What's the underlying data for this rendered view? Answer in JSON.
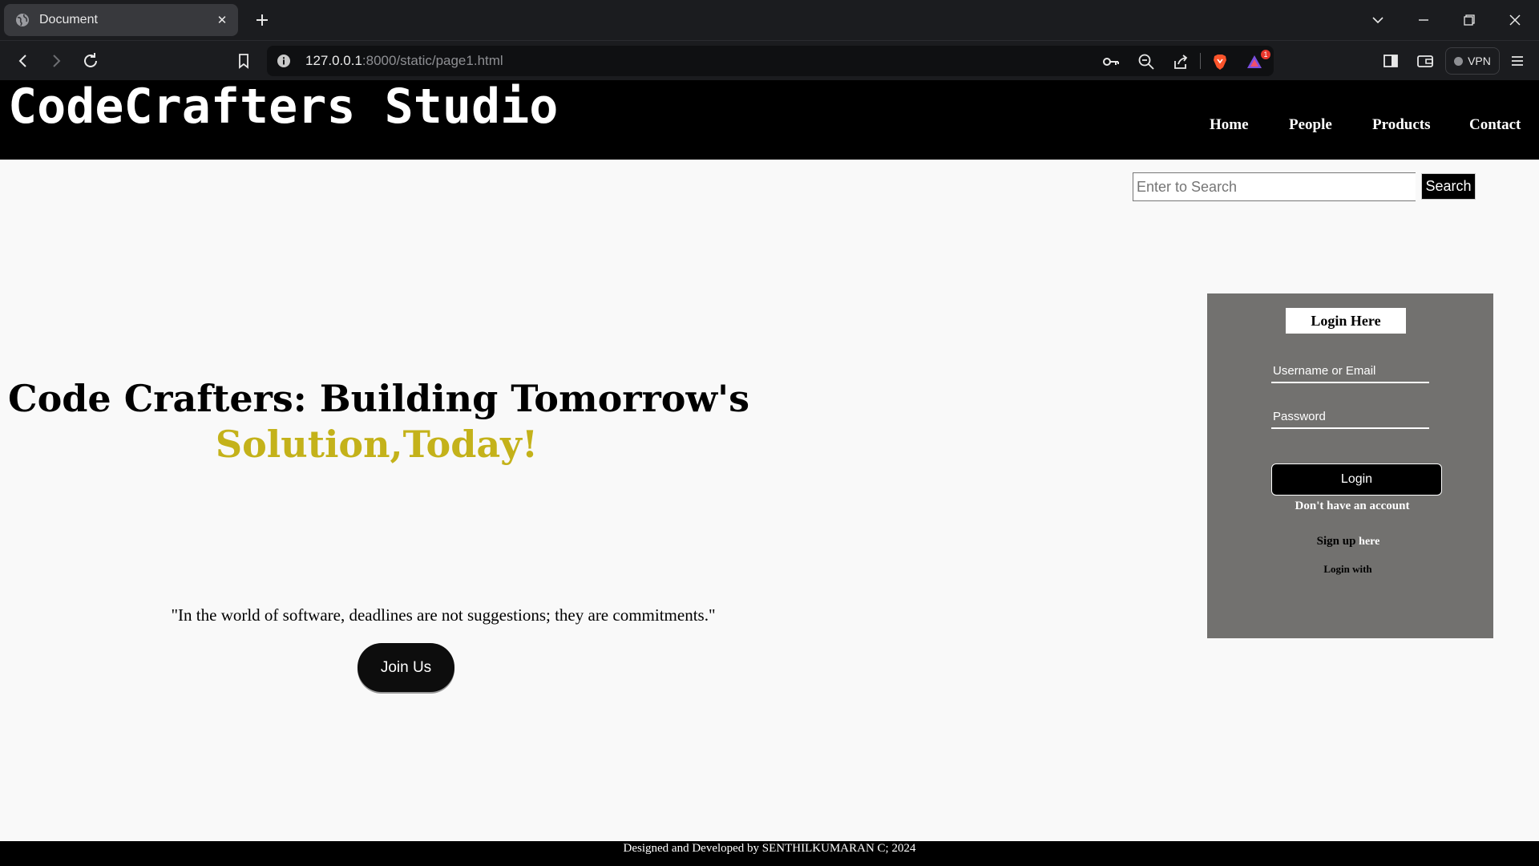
{
  "browser": {
    "tab_title": "Document",
    "url_host": "127.0.0.1",
    "url_rest": ":8000/static/page1.html",
    "vpn_label": "VPN",
    "notification_count": "1",
    "icons": [
      "globe-icon",
      "close-icon",
      "plus-icon",
      "chevron-down-icon",
      "minimize-icon",
      "restore-icon",
      "close-window-icon",
      "back-icon",
      "forward-icon",
      "reload-icon",
      "bookmark-icon",
      "info-icon",
      "key-icon",
      "zoom-out-icon",
      "share-icon",
      "brave-shield-icon",
      "rewards-icon",
      "sidebar-icon",
      "wallet-icon",
      "menu-icon"
    ]
  },
  "site": {
    "brand": "CodeCrafters Studio",
    "nav": [
      "Home",
      "People",
      "Products",
      "Contact"
    ],
    "search": {
      "placeholder": "Enter to Search",
      "button": "Search"
    },
    "hero": {
      "line1": "Code Crafters: Building Tomorrow's",
      "line2": "Solution,Today!"
    },
    "quote": "\"In the world of software, deadlines are not suggestions; they are commitments.\"",
    "join_button": "Join Us",
    "login": {
      "title": "Login Here",
      "username_placeholder": "Username or Email",
      "password_placeholder": "Password",
      "button": "Login",
      "no_account": "Don't have an account",
      "signup_bold": "Sign up",
      "signup_link": "here",
      "login_with": "Login with"
    },
    "footer": "Designed and Developed by SENTHILKUMARAN C; 2024"
  },
  "colors": {
    "hero_accent": "#c4b21a",
    "header_bg": "#000000",
    "login_panel_bg": "#72716f",
    "page_bg": "#f9f9f9"
  }
}
